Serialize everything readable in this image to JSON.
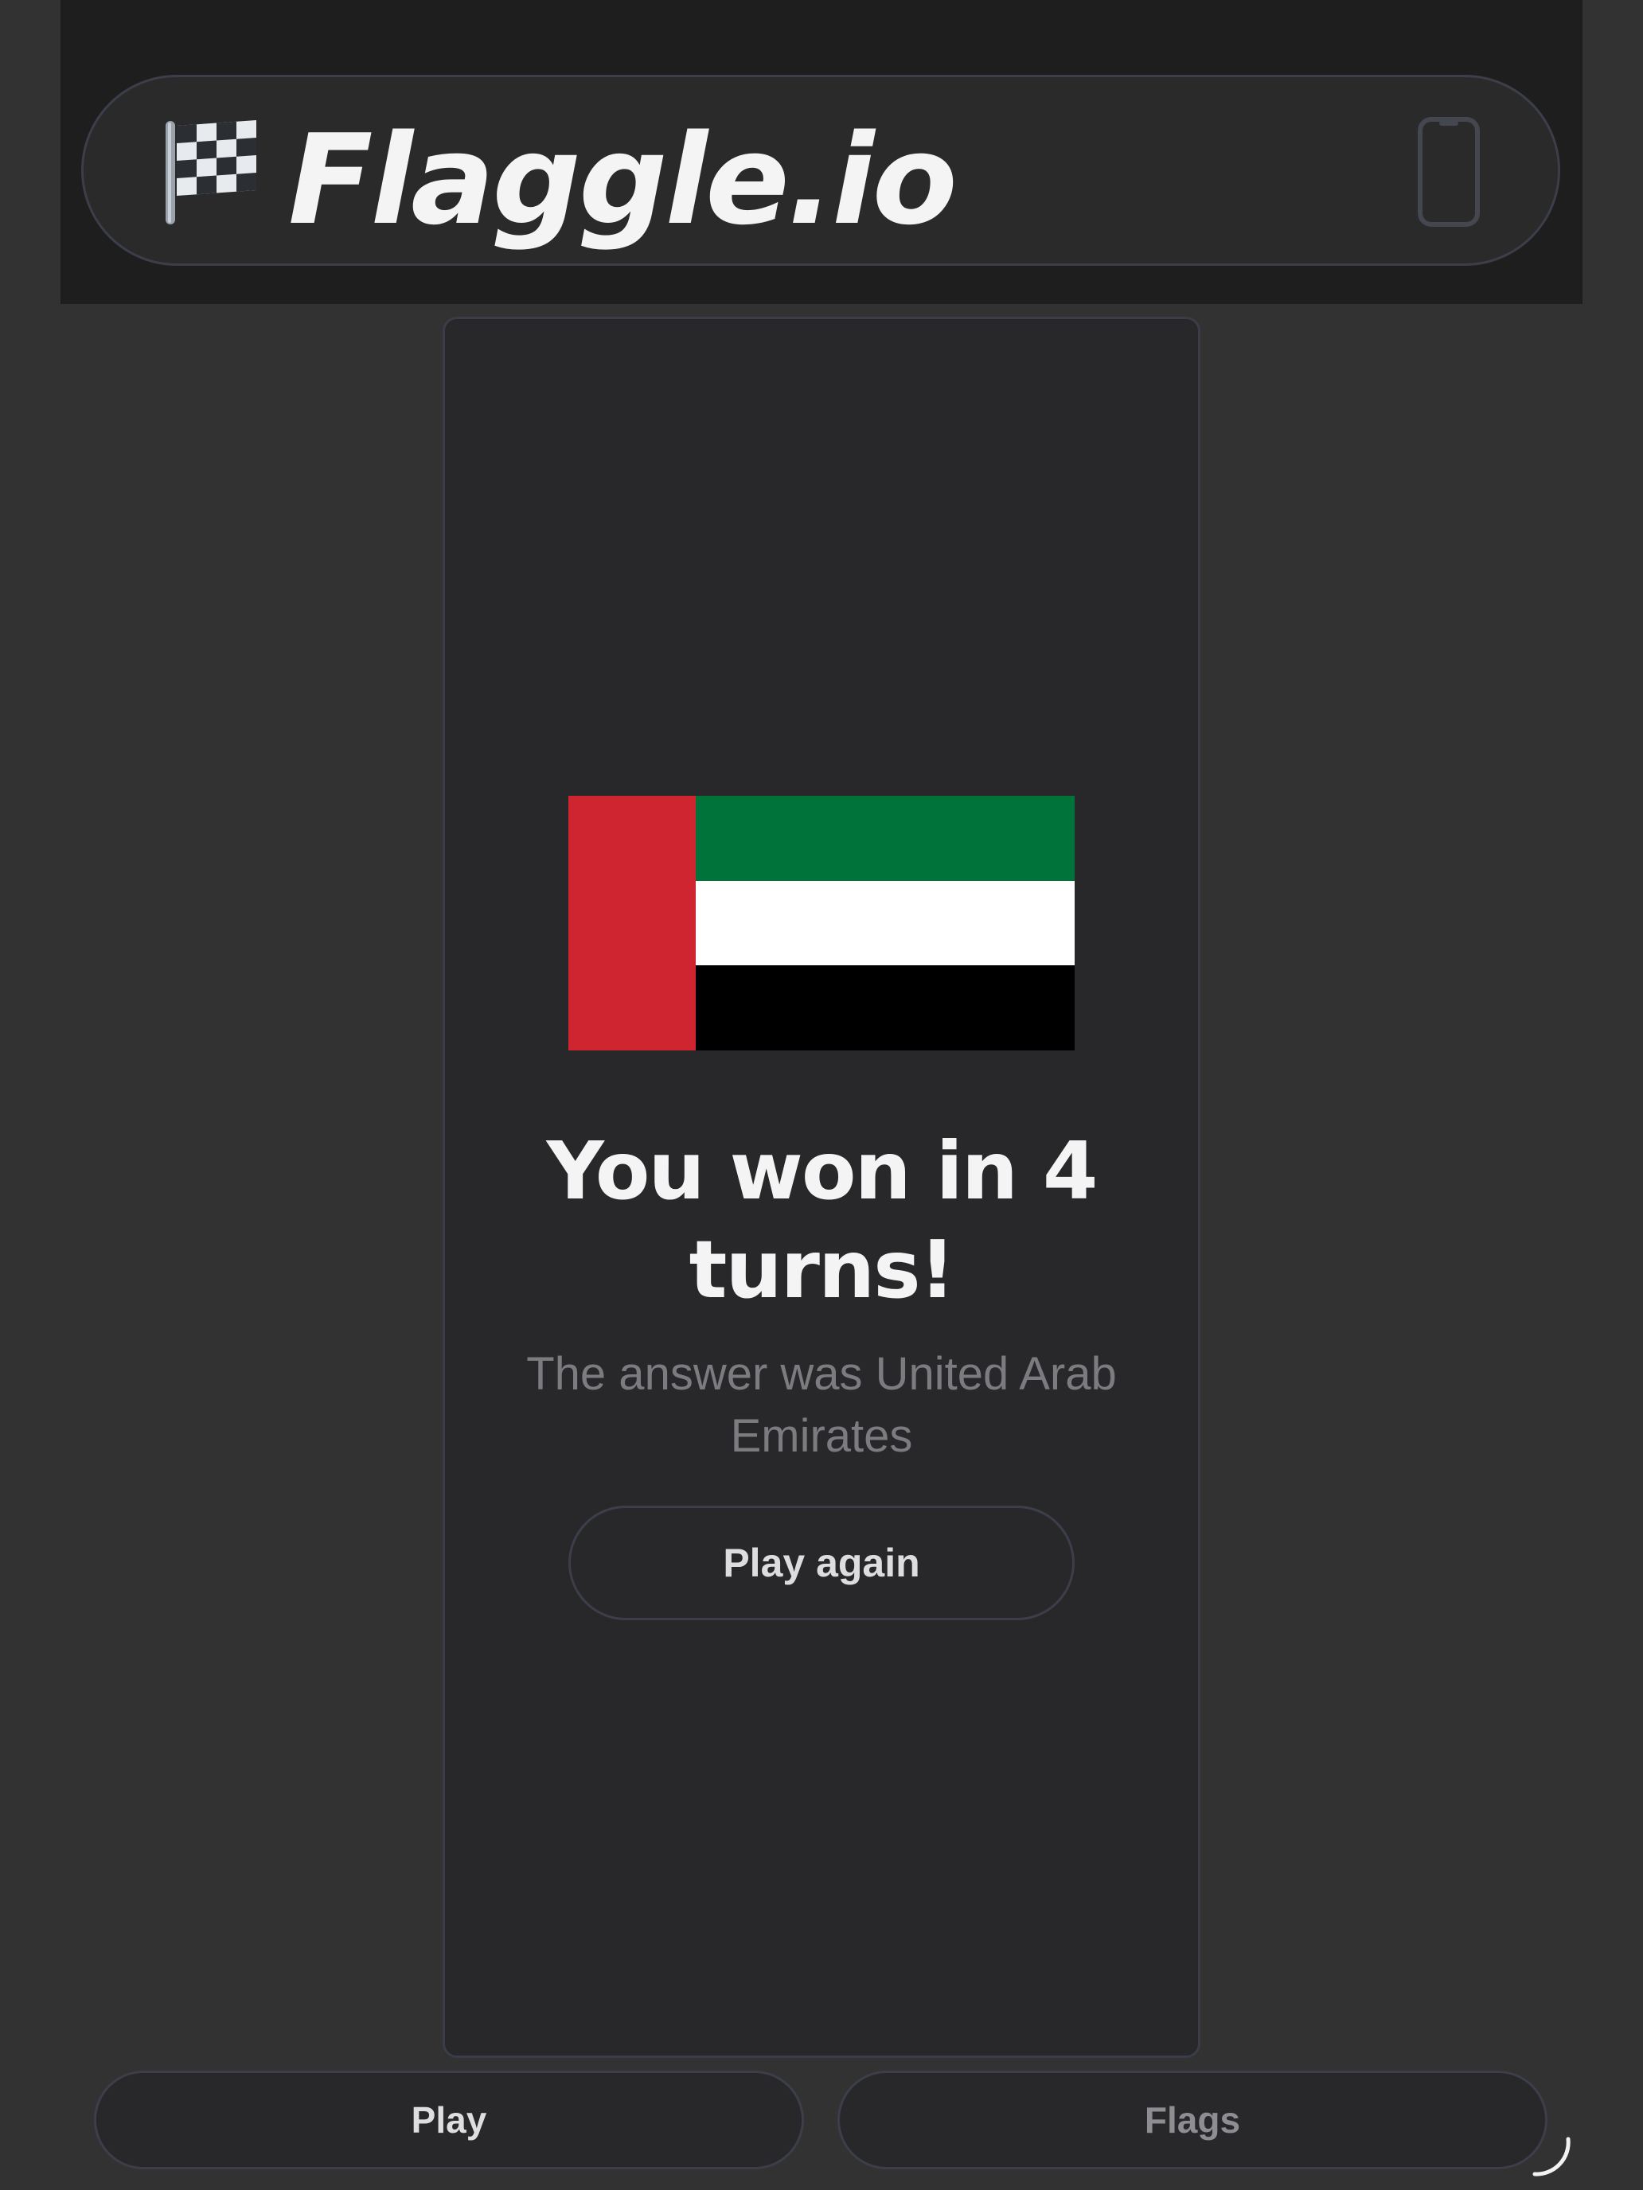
{
  "header": {
    "title": "Flaggle.io",
    "logo_icon": "checkered-flag-icon",
    "device_icon": "phone-icon"
  },
  "result": {
    "flag_icon": "uae-flag-icon",
    "title_line1": "You won in 4",
    "title_line2": "turns!",
    "subtitle_line1": "The answer was United Arab",
    "subtitle_line2": "Emirates",
    "play_again_label": "Play again"
  },
  "bottom_nav": {
    "play_label": "Play",
    "flags_label": "Flags"
  },
  "colors": {
    "background": "#323232",
    "header_strip": "#1e1e1f",
    "card": "#28282a",
    "border": "#3c3e4a",
    "uae_red": "#ce2530",
    "uae_green": "#00733a",
    "uae_white": "#ffffff",
    "uae_black": "#000000"
  }
}
